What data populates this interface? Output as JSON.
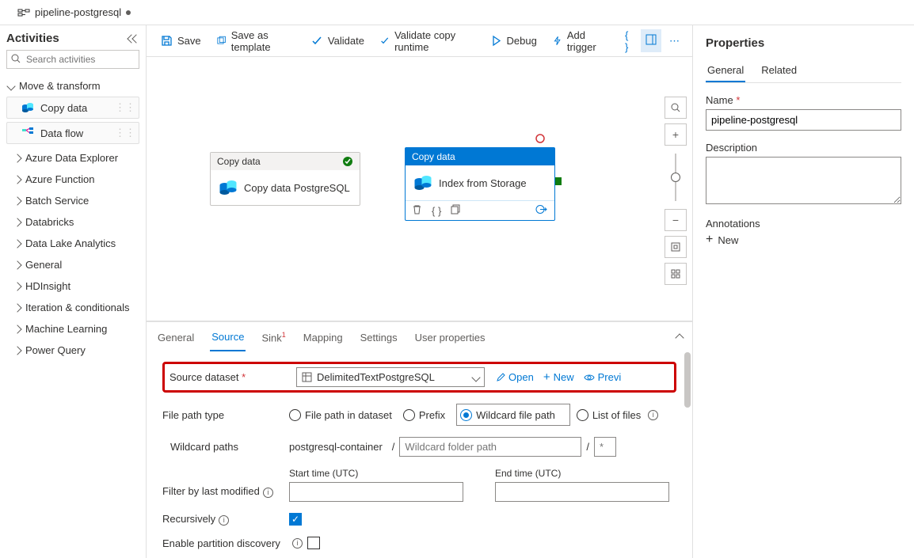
{
  "tab": {
    "label": "pipeline-postgresql"
  },
  "sidebar": {
    "title": "Activities",
    "search_placeholder": "Search activities",
    "groups": {
      "move_transform": "Move & transform",
      "copy_data": "Copy data",
      "data_flow": "Data flow"
    },
    "items": [
      "Azure Data Explorer",
      "Azure Function",
      "Batch Service",
      "Databricks",
      "Data Lake Analytics",
      "General",
      "HDInsight",
      "Iteration & conditionals",
      "Machine Learning",
      "Power Query"
    ]
  },
  "toolbar": {
    "save": "Save",
    "save_template": "Save as template",
    "validate": "Validate",
    "validate_runtime": "Validate copy runtime",
    "debug": "Debug",
    "add_trigger": "Add trigger"
  },
  "canvas": {
    "act1": {
      "header": "Copy data",
      "label": "Copy data PostgreSQL"
    },
    "act2": {
      "header": "Copy data",
      "label": "Index from Storage"
    }
  },
  "bottom_tabs": [
    "General",
    "Source",
    "Sink",
    "Mapping",
    "Settings",
    "User properties"
  ],
  "form": {
    "source_dataset_label": "Source dataset",
    "source_dataset_value": "DelimitedTextPostgreSQL",
    "open": "Open",
    "new": "New",
    "preview": "Previ",
    "file_path_type_label": "File path type",
    "opt_file_in_dataset": "File path in dataset",
    "opt_prefix": "Prefix",
    "opt_wildcard": "Wildcard file path",
    "opt_list": "List of files",
    "wildcard_paths_label": "Wildcard paths",
    "container": "postgresql-container",
    "wildcard_placeholder": "Wildcard folder path",
    "wildcard_file_placeholder": "*",
    "start_time": "Start time (UTC)",
    "end_time": "End time (UTC)",
    "filter_label": "Filter by last modified",
    "recursively_label": "Recursively",
    "partition_label": "Enable partition discovery"
  },
  "props": {
    "title": "Properties",
    "tab_general": "General",
    "tab_related": "Related",
    "name_label": "Name",
    "name_value": "pipeline-postgresql",
    "desc_label": "Description",
    "annotations_label": "Annotations",
    "new": "New"
  }
}
